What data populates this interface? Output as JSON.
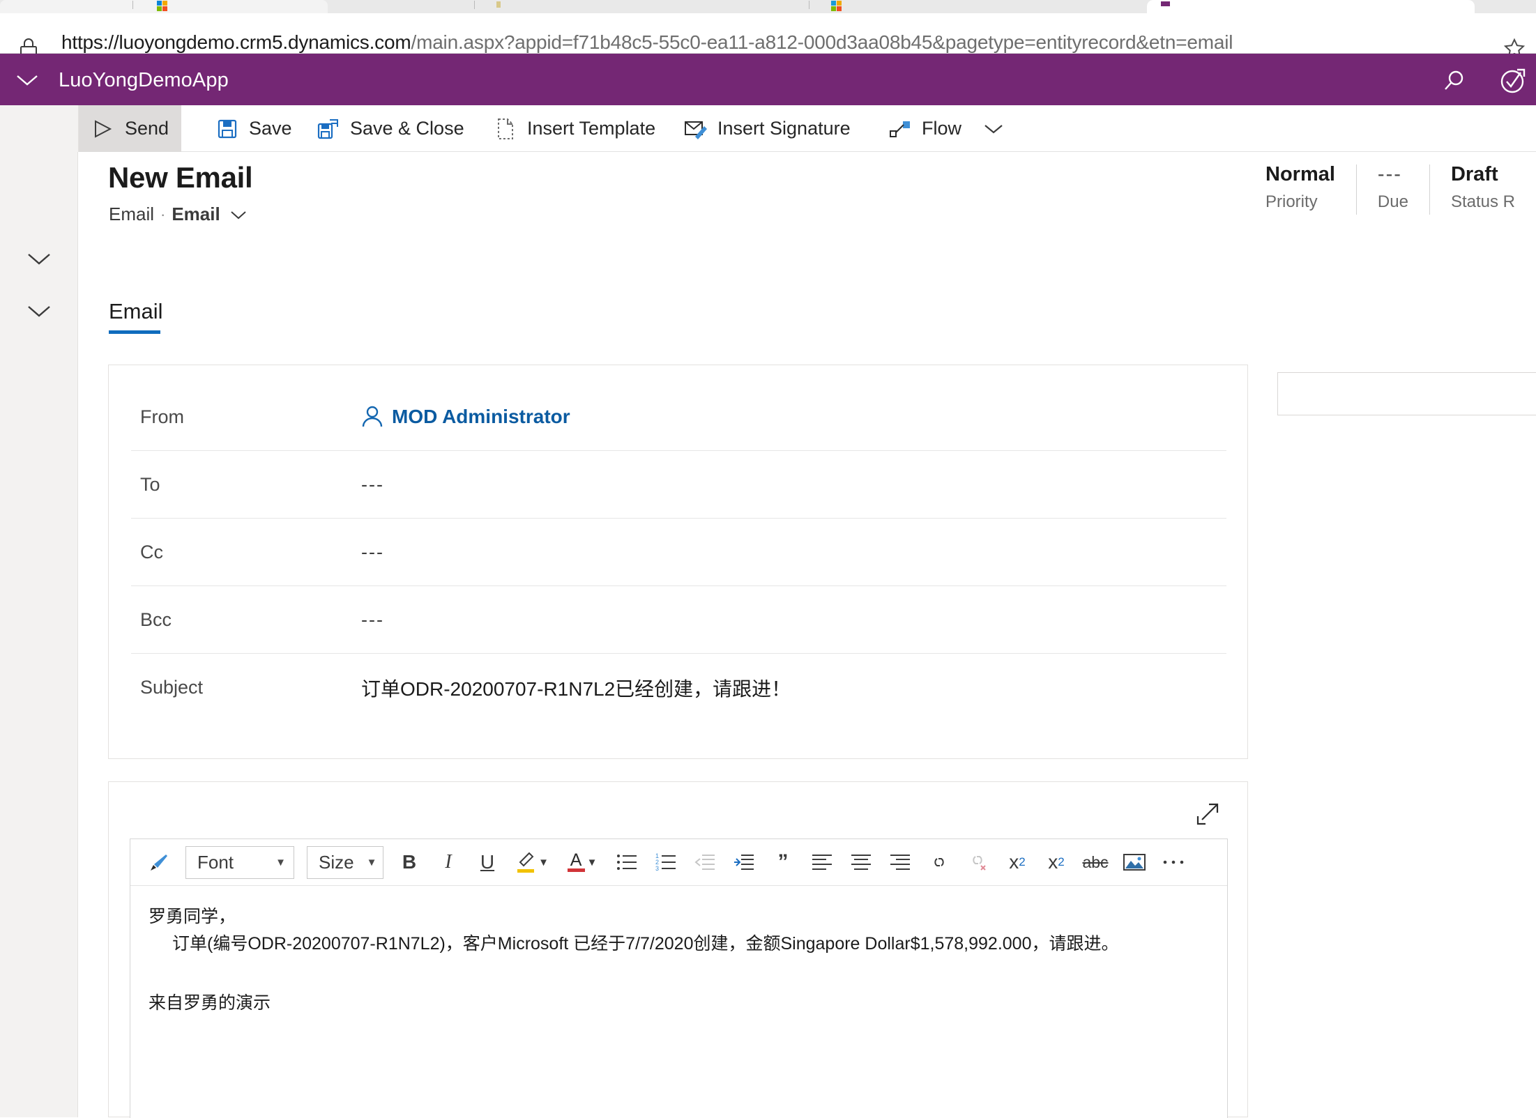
{
  "browser": {
    "url_host": "https://luoyongdemo.crm5.dynamics.com",
    "url_path": "/main.aspx?appid=f71b48c5-55c0-ea11-a812-000d3aa08b45&pagetype=entityrecord&etn=email",
    "lock_icon": "lock-icon",
    "star_icon": "favorite-star-icon"
  },
  "appbar": {
    "title": "LuoYongDemoApp",
    "color": "#742774",
    "chevron_icon": "chevron-down-icon",
    "search_icon": "search-icon",
    "assistant_icon": "relationship-assistant-icon"
  },
  "commandbar": {
    "buttons": [
      {
        "label": "Send",
        "icon": "send-icon",
        "active": true
      },
      {
        "label": "Save",
        "icon": "save-disk-icon",
        "active": false
      },
      {
        "label": "Save & Close",
        "icon": "save-and-close-icon",
        "active": false
      },
      {
        "label": "Insert Template",
        "icon": "insert-template-icon",
        "active": false
      },
      {
        "label": "Insert Signature",
        "icon": "insert-signature-icon",
        "active": false
      },
      {
        "label": "Flow",
        "icon": "flow-icon",
        "active": false
      }
    ],
    "overflow_icon": "chevron-down-icon"
  },
  "header": {
    "title": "New Email",
    "entity": "Email",
    "separator": "·",
    "form_name": "Email",
    "form_chevron_icon": "chevron-down-icon",
    "stats": [
      {
        "value": "Normal",
        "label": "Priority",
        "muted": false
      },
      {
        "value": "---",
        "label": "Due",
        "muted": true
      },
      {
        "value": "Draft",
        "label": "Status R",
        "muted": false
      }
    ]
  },
  "tabs": [
    {
      "label": "Email",
      "selected": true,
      "accent": "#0f6cbd"
    }
  ],
  "form": {
    "rows": [
      {
        "label": "From",
        "value": "MOD Administrator",
        "type": "person",
        "icon": "person-icon"
      },
      {
        "label": "To",
        "value": "---",
        "type": "empty"
      },
      {
        "label": "Cc",
        "value": "---",
        "type": "empty"
      },
      {
        "label": "Bcc",
        "value": "---",
        "type": "empty"
      },
      {
        "label": "Subject",
        "value": "订单ODR-20200707-R1N7L2已经创建，请跟进！",
        "type": "cjk"
      }
    ]
  },
  "editor": {
    "expand_icon": "expand-icon",
    "toolbar": {
      "format_painter_icon": "format-painter-icon",
      "font_label": "Font",
      "size_label": "Size",
      "bold_label": "B",
      "italic_label": "I",
      "underline_label": "U",
      "highlight_icon": "highlight-color-icon",
      "fontcolor_label": "A",
      "bullet_list_icon": "bulleted-list-icon",
      "numbered_list_icon": "numbered-list-icon",
      "outdent_icon": "decrease-indent-icon",
      "indent_icon": "increase-indent-icon",
      "blockquote_label": "”",
      "align_left_icon": "align-left-icon",
      "align_center_icon": "align-center-icon",
      "align_right_icon": "align-right-icon",
      "link_icon": "insert-link-icon",
      "unlink_icon": "remove-link-icon",
      "superscript_label": "x",
      "superscript_sup": "2",
      "subscript_label": "x",
      "subscript_sub": "2",
      "strikethrough_label": "abc",
      "image_icon": "insert-image-icon",
      "more_icon": "more-options-icon"
    },
    "body": {
      "line1": "罗勇同学，",
      "line2": "订单(编号ODR-20200707-R1N7L2)，客户Microsoft 已经于7/7/2020创建，金额Singapore Dollar$1,578,992.000，请跟进。",
      "line3": "来自罗勇的演示"
    }
  },
  "leftrail": {
    "chevron_top_icon": "chevron-down-icon",
    "chevron_bottom_icon": "chevron-down-icon"
  }
}
